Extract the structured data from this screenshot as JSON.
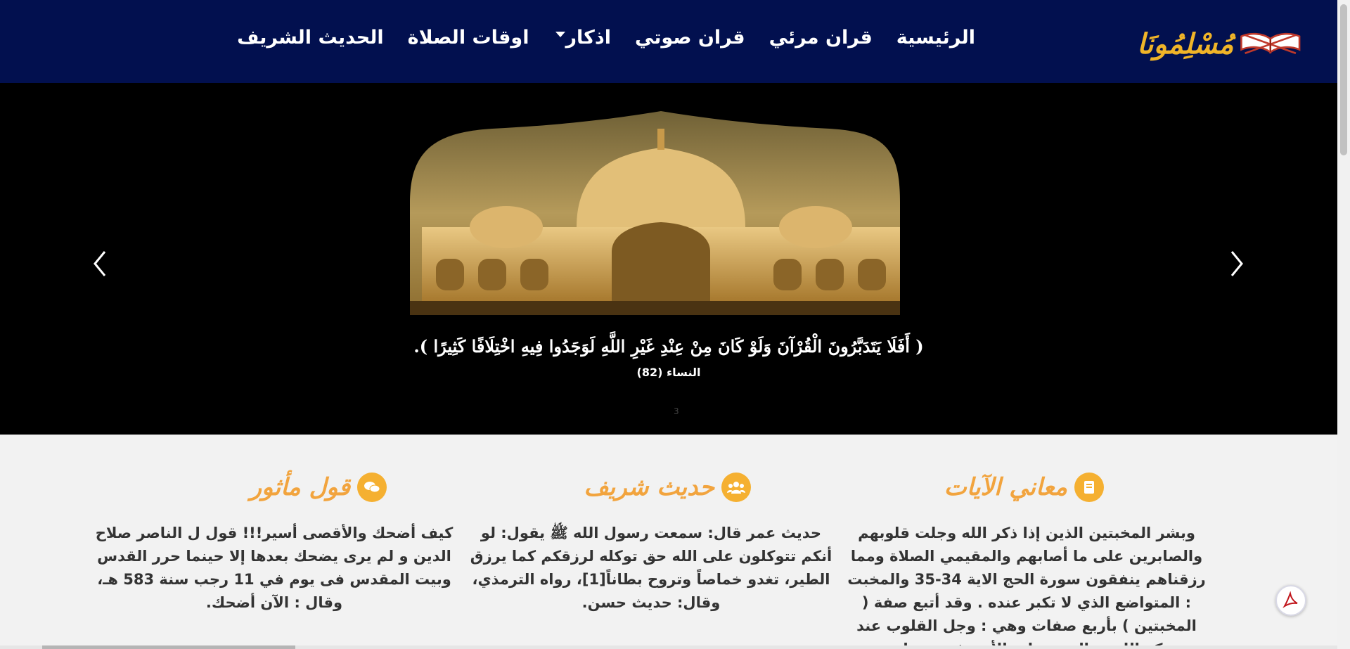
{
  "nav": {
    "logo_text": "مُسْلِمُونَا",
    "links": [
      "الرئيسية",
      "قران مرئي",
      "قران صوتي",
      "اذكار",
      "اوقات الصلاة",
      "الحديث الشريف"
    ]
  },
  "hero": {
    "verse": "( أَفَلَا يَتَدَبَّرُونَ الْقُرْآنَ وَلَوْ كَانَ مِنْ عِنْدِ غَيْرِ اللَّهِ لَوَجَدُوا فِيهِ اخْتِلَافًا كَثِيرًا ).",
    "reference": "النساء (82)",
    "indicator": "3"
  },
  "sections": [
    {
      "title": "معاني الآيات",
      "icon": "book-icon",
      "text": "وبشر المخبتين الذين إذا ذكر الله وجلت قلوبهم والصابرين على ما أصابهم والمقيمي الصلاة ومما رزقناهم ينفقون سورة الحج الاية 34-35 والمخبت : المتواضع الذي لا تكبر عنده . وقد أتبع صفة ( المخبتين ) بأربع صفات وهي : وجل القلوب عند ذكر الله ، والصبر على الأذى في سبيله ،"
    },
    {
      "title": "حديث شريف",
      "icon": "users-icon",
      "text": "حديث عمر قال: سمعت رسول الله ﷺ يقول: لو أنكم تتوكلون على الله حق توكله لرزقكم كما يرزق الطير، تغدو خماصاً وتروح بطاناً[1]، رواه الترمذي، وقال: حديث حسن."
    },
    {
      "title": "قول مأثور",
      "icon": "comments-icon",
      "text": "كيف أضحك والأقصى أسير!!! قول ل الناصر صلاح الدين و لم يرى يضحك بعدها إلا حينما حرر القدس وبيت المقدس فى يوم في 11 رجب سنة 583 هـ، وقال : الآن أضحك."
    }
  ],
  "colors": {
    "navbar": "#02104f",
    "accent": "#f5b031",
    "title": "#f2a43e"
  }
}
